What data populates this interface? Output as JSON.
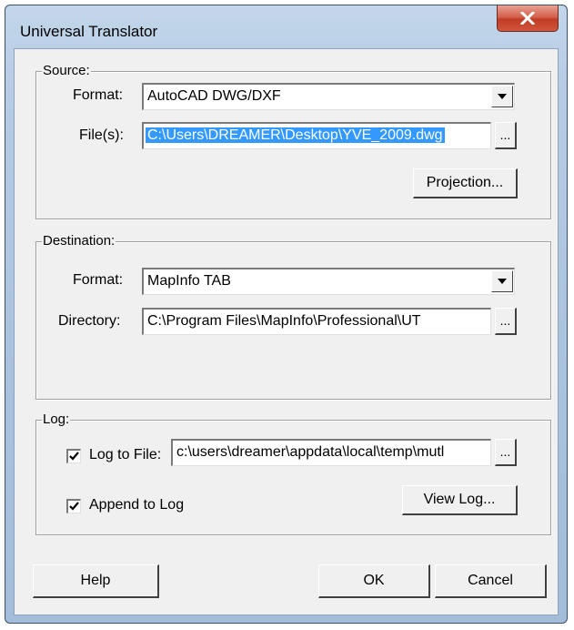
{
  "window": {
    "title": "Universal Translator"
  },
  "source": {
    "legend": "Source:",
    "format_label": "Format:",
    "format_value": "AutoCAD DWG/DXF",
    "files_label": "File(s):",
    "files_value": "C:\\Users\\DREAMER\\Desktop\\YVE_2009.dwg",
    "browse_label": "...",
    "projection_label": "Projection..."
  },
  "destination": {
    "legend": "Destination:",
    "format_label": "Format:",
    "format_value": "MapInfo TAB",
    "directory_label": "Directory:",
    "directory_value": "C:\\Program Files\\MapInfo\\Professional\\UT",
    "browse_label": "..."
  },
  "log": {
    "legend": "Log:",
    "log_to_file_label": "Log to File:",
    "log_to_file_checked": true,
    "log_file_value": "c:\\users\\dreamer\\appdata\\local\\temp\\mutl",
    "browse_label": "...",
    "append_label": "Append to Log",
    "append_checked": true,
    "view_log_label": "View Log..."
  },
  "buttons": {
    "help": "Help",
    "ok": "OK",
    "cancel": "Cancel"
  }
}
